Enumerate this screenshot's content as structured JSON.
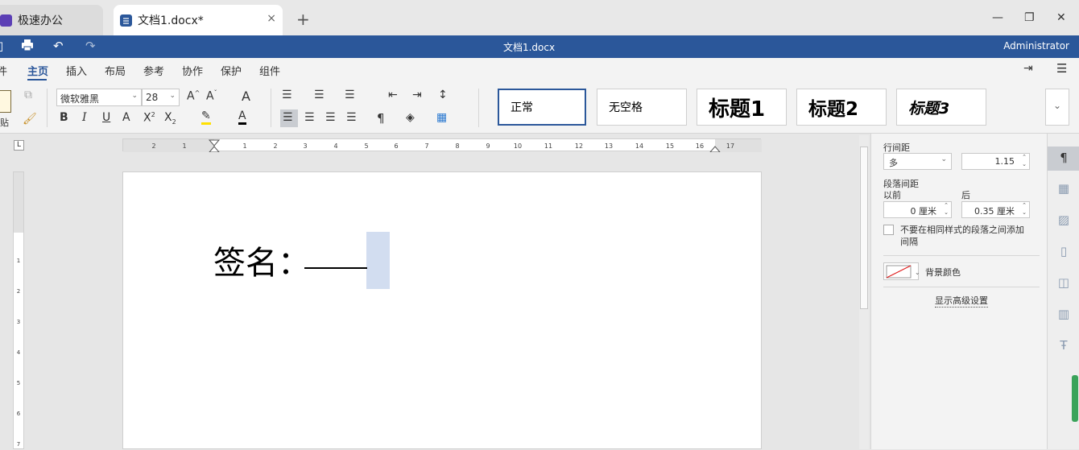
{
  "tabs": {
    "app": {
      "label": "极速办公"
    },
    "document": {
      "label": "文档1.docx*"
    },
    "new_tab": "+",
    "close": "×"
  },
  "window": {
    "minimize": "—",
    "restore": "❐",
    "close": "✕"
  },
  "titlebar": {
    "title": "文档1.docx",
    "user": "Administrator"
  },
  "menu": {
    "items": [
      "件",
      "主页",
      "插入",
      "布局",
      "参考",
      "协作",
      "保护",
      "组件"
    ],
    "active": "主页"
  },
  "ribbon": {
    "paste_label": "贴",
    "font_name": "微软雅黑",
    "font_size": "28",
    "styles": [
      "正常",
      "无空格",
      "标题1",
      "标题2",
      "标题3"
    ],
    "selected_style": "正常"
  },
  "document": {
    "text": "签名："
  },
  "side_panel": {
    "line_spacing_label": "行间距",
    "line_spacing_mode": "多",
    "line_spacing_value": "1.15",
    "para_spacing_label": "段落间距",
    "before_label": "以前",
    "after_label": "后",
    "before_value": "0 厘米",
    "after_value": "0.35 厘米",
    "no_space_same_style": "不要在相同样式的段落之间添加间隔",
    "bg_color_label": "背景颜色",
    "advanced_link": "显示高级设置"
  },
  "colors": {
    "accent": "#2b579a",
    "highlight": "#d2ddf0"
  }
}
